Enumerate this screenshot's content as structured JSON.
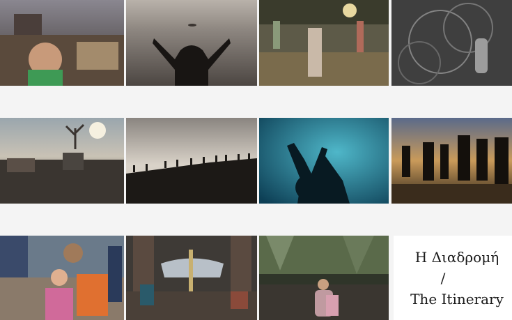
{
  "caption": {
    "title_greek": "Η Διαδρομή",
    "separator": "/",
    "title_english": "The Itinerary"
  },
  "photos": [
    {
      "id": "photo-child-crowd",
      "tone": "color"
    },
    {
      "id": "photo-raised-arms-sea",
      "tone": "sepia"
    },
    {
      "id": "photo-fence-night",
      "tone": "color"
    },
    {
      "id": "photo-barbed-wire-hand",
      "tone": "grayscale"
    },
    {
      "id": "photo-camp-tree",
      "tone": "color"
    },
    {
      "id": "photo-silhouette-line",
      "tone": "sepia"
    },
    {
      "id": "photo-hands-blue-tarp",
      "tone": "blue"
    },
    {
      "id": "photo-night-walkers",
      "tone": "color"
    },
    {
      "id": "photo-man-child-lifejacket",
      "tone": "color"
    },
    {
      "id": "photo-boat-shelter",
      "tone": "color"
    },
    {
      "id": "photo-woman-rocks",
      "tone": "color"
    }
  ]
}
